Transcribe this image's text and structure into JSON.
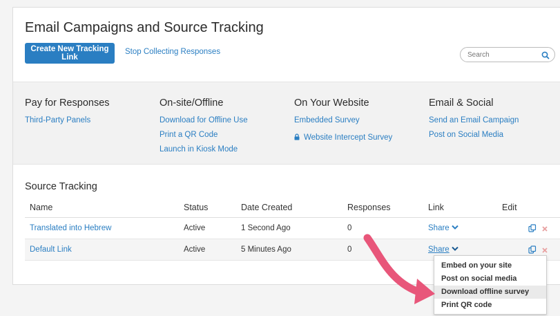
{
  "header": {
    "title": "Email Campaigns and Source Tracking",
    "create_button": "Create New Tracking Link",
    "stop_link": "Stop Collecting Responses",
    "search_placeholder": "Search"
  },
  "channels": [
    {
      "heading": "Pay for Responses",
      "links": [
        "Third-Party Panels"
      ]
    },
    {
      "heading": "On-site/Offline",
      "links": [
        "Download for Offline Use",
        "Print a QR Code",
        "Launch in Kiosk Mode"
      ]
    },
    {
      "heading": "On Your Website",
      "links": [
        "Embedded Survey",
        "Website Intercept Survey"
      ]
    },
    {
      "heading": "Email & Social",
      "links": [
        "Send an Email Campaign",
        "Post on Social Media"
      ]
    }
  ],
  "source_tracking": {
    "title": "Source Tracking",
    "columns": [
      "Name",
      "Status",
      "Date Created",
      "Responses",
      "Link",
      "Edit"
    ],
    "rows": [
      {
        "name": "Translated into Hebrew",
        "status": "Active",
        "date": "1 Second Ago",
        "responses": "0",
        "link": "Share"
      },
      {
        "name": "Default Link",
        "status": "Active",
        "date": "5 Minutes Ago",
        "responses": "0",
        "link": "Share"
      }
    ]
  },
  "share_menu": {
    "items": [
      "Embed on your site",
      "Post on social media",
      "Download offline survey",
      "Print QR code"
    ],
    "highlighted_index": 2
  },
  "colors": {
    "accent": "#2a7ec2",
    "arrow": "#e8567a",
    "delete": "#e8a0a0"
  },
  "icons": {
    "search": "search-icon",
    "lock": "lock-icon",
    "copy": "copy-icon",
    "delete": "close-icon",
    "chevron": "chevron-down-icon"
  }
}
